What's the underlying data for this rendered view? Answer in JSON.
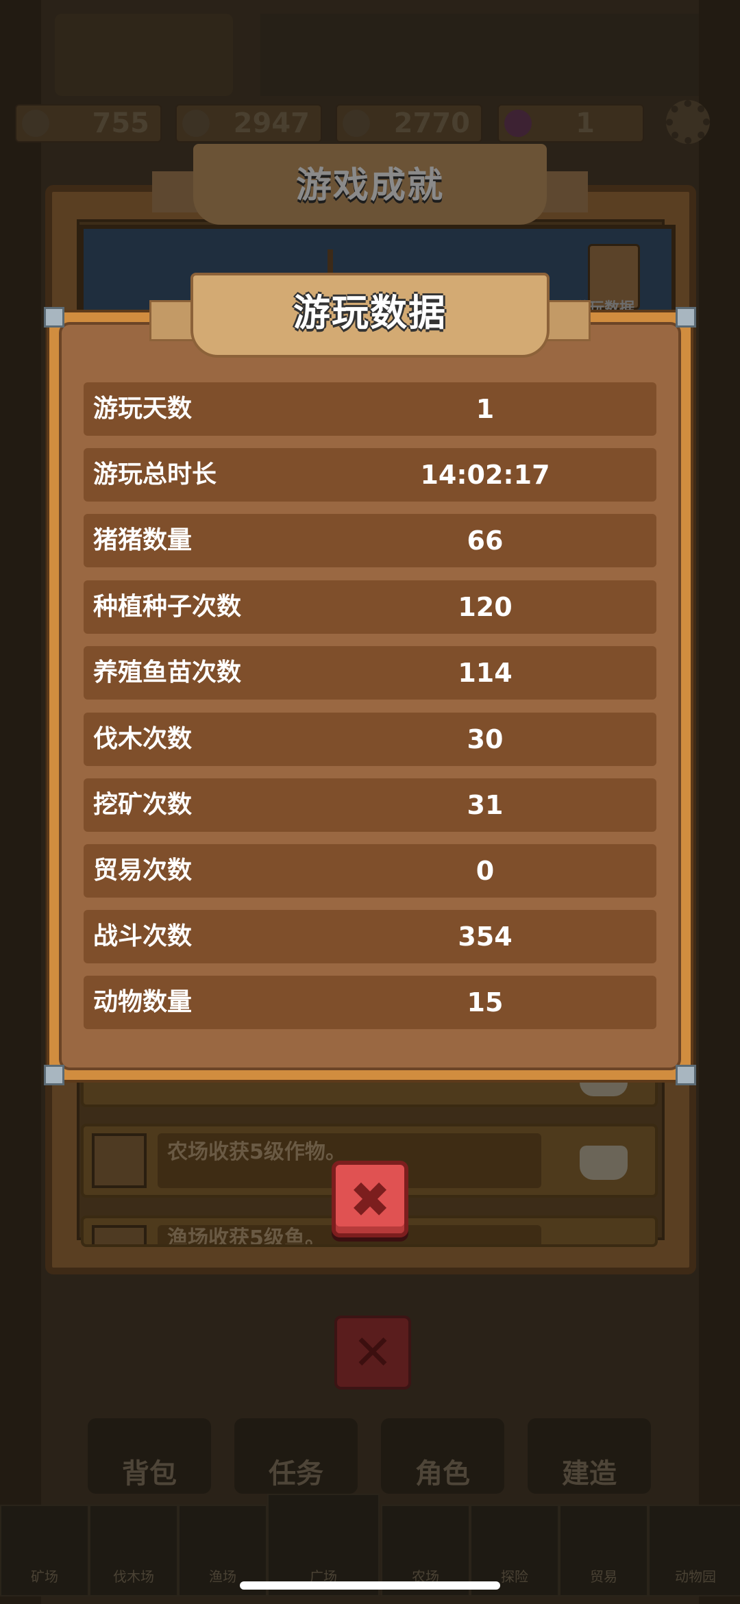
{
  "resources": {
    "gold": "755",
    "resource2": "2947",
    "resource3": "2770",
    "hearts": "1"
  },
  "achievements": {
    "title": "游戏成就",
    "tab_label": "游玩数据",
    "items": [
      {
        "text": ""
      },
      {
        "text": "农场收获5级作物。"
      },
      {
        "text": "渔场收获5级鱼。"
      }
    ]
  },
  "play_data": {
    "title": "游玩数据",
    "rows": [
      {
        "label": "游玩天数",
        "value": "1"
      },
      {
        "label": "游玩总时长",
        "value": "14:02:17"
      },
      {
        "label": "猪猪数量",
        "value": "66"
      },
      {
        "label": "种植种子次数",
        "value": "120"
      },
      {
        "label": "养殖鱼苗次数",
        "value": "114"
      },
      {
        "label": "伐木次数",
        "value": "30"
      },
      {
        "label": "挖矿次数",
        "value": "31"
      },
      {
        "label": "贸易次数",
        "value": "0"
      },
      {
        "label": "战斗次数",
        "value": "354"
      },
      {
        "label": "动物数量",
        "value": "15"
      }
    ]
  },
  "close_icon": "close-x-icon",
  "bottom_buttons": [
    "背包",
    "任务",
    "角色",
    "建造"
  ],
  "bottom_tabs": [
    "矿场",
    "伐木场",
    "渔场",
    "广场",
    "农场",
    "探险",
    "贸易",
    "动物园"
  ],
  "colors": {
    "panel_bg": "#9a6842",
    "row_bg": "#7f4f2b",
    "close_button": "#e05252"
  }
}
